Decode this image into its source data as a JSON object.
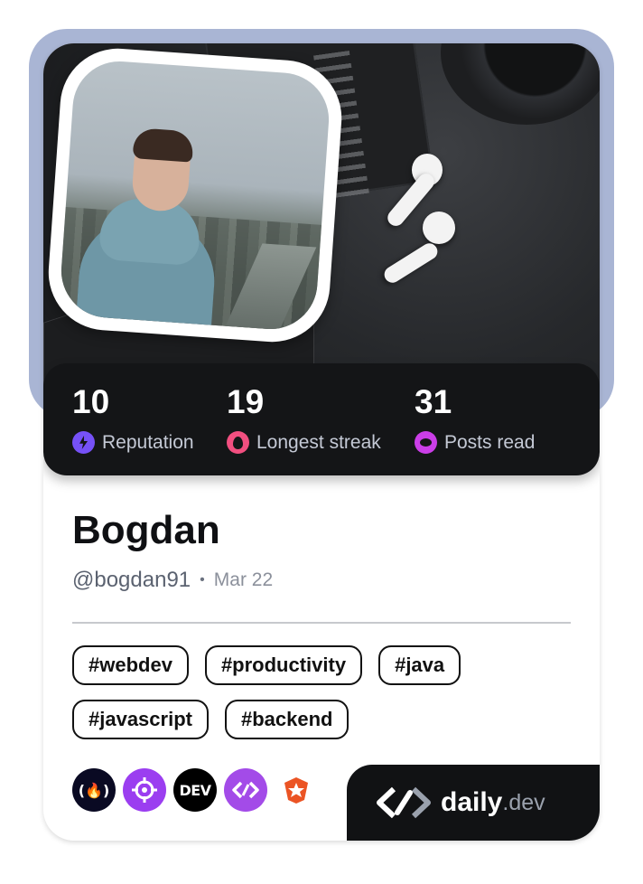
{
  "profile": {
    "name": "Bogdan",
    "handle": "@bogdan91",
    "separator": "•",
    "joined": "Mar 22"
  },
  "stats": [
    {
      "value": "10",
      "label": "Reputation",
      "icon": "bolt-icon",
      "color": "#7651f7"
    },
    {
      "value": "19",
      "label": "Longest streak",
      "icon": "flame-icon",
      "color": "#f24f80"
    },
    {
      "value": "31",
      "label": "Posts read",
      "icon": "eye-icon",
      "color": "#cb3ee8"
    }
  ],
  "tags": [
    "#webdev",
    "#productivity",
    "#java",
    "#javascript",
    "#backend"
  ],
  "sources": [
    {
      "name": "freecodecamp-icon",
      "glyph": "(🔥)"
    },
    {
      "name": "crosshair-icon",
      "glyph": "⌖"
    },
    {
      "name": "dev-icon",
      "glyph": "DEV"
    },
    {
      "name": "daily-dev-source-icon",
      "glyph": "‹/›"
    },
    {
      "name": "auth0-icon",
      "glyph": "★"
    }
  ],
  "brand": {
    "name": "daily",
    "suffix": ".dev"
  },
  "colors": {
    "frame": "#a9b5d4",
    "stats_bg": "#141517",
    "brand_bg": "#111214"
  }
}
